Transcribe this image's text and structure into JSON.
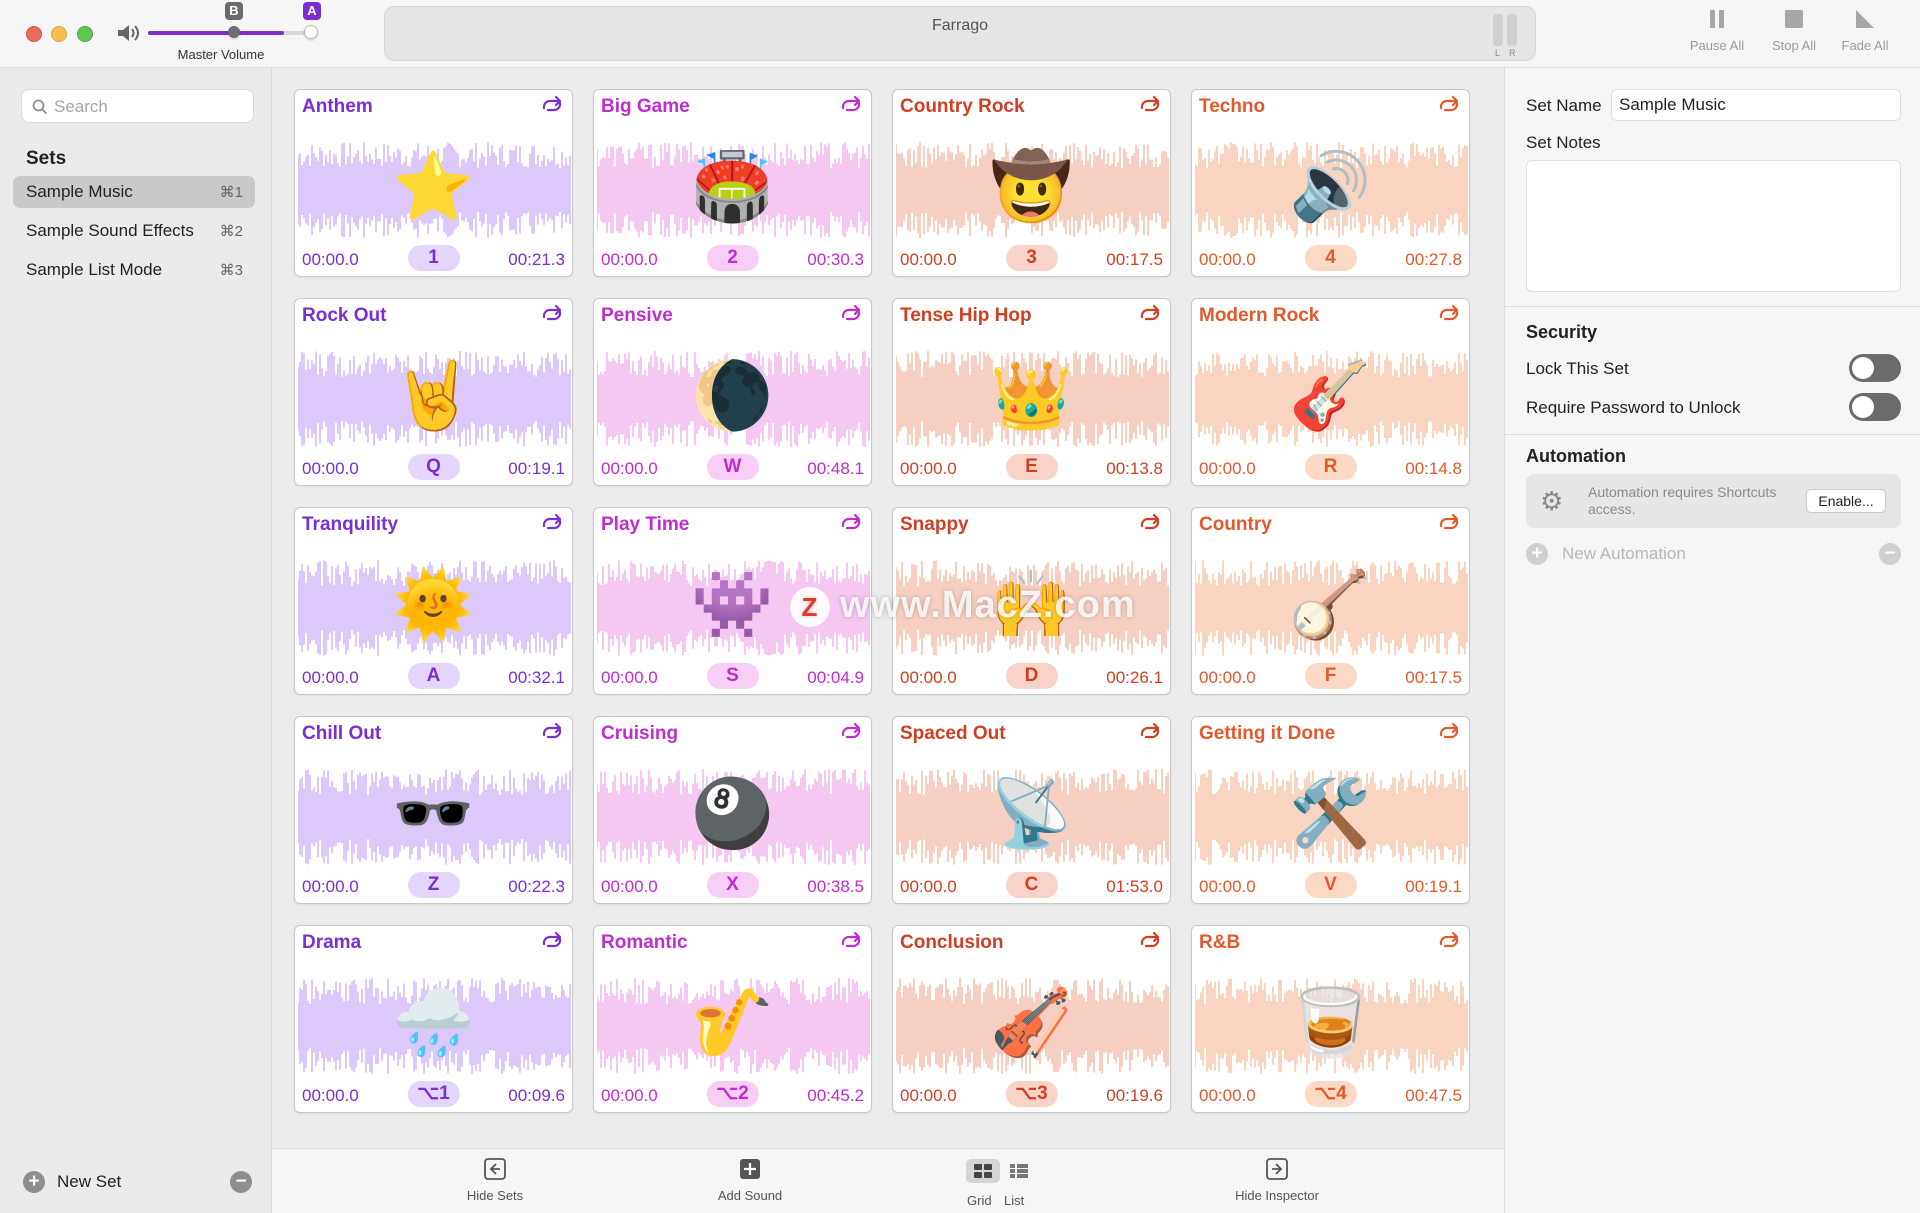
{
  "window": {
    "title": "Farrago"
  },
  "volume": {
    "label": "Master Volume",
    "marker_b": "B",
    "marker_a": "A",
    "level": 0.83
  },
  "meter": {
    "left": "L",
    "right": "R"
  },
  "toolbar": {
    "pause_all": "Pause All",
    "stop_all": "Stop All",
    "fade_all": "Fade All"
  },
  "sidebar": {
    "search_placeholder": "Search",
    "sets_heading": "Sets",
    "sets": [
      {
        "name": "Sample Music",
        "shortcut": "⌘1",
        "active": true
      },
      {
        "name": "Sample Sound Effects",
        "shortcut": "⌘2",
        "active": false
      },
      {
        "name": "Sample List Mode",
        "shortcut": "⌘3",
        "active": false
      }
    ],
    "new_set": "New Set"
  },
  "colors": {
    "purple": "#7b2fd0",
    "pink": "#c02ccf",
    "salmon": "#d03f22",
    "orange": "#e3592c"
  },
  "tiles": [
    {
      "title": "Anthem",
      "emoji": "⭐",
      "key": "1",
      "start": "00:00.0",
      "duration": "00:21.3",
      "color": "purple",
      "wave": "#dcc8fa"
    },
    {
      "title": "Big Game",
      "emoji": "🏟️",
      "key": "2",
      "start": "00:00.0",
      "duration": "00:30.3",
      "color": "pink",
      "wave": "#f4c8f1"
    },
    {
      "title": "Country Rock",
      "emoji": "🤠",
      "key": "3",
      "start": "00:00.0",
      "duration": "00:17.5",
      "color": "salmon",
      "wave": "#f7cfc2"
    },
    {
      "title": "Techno",
      "emoji": "🔊",
      "key": "4",
      "start": "00:00.0",
      "duration": "00:27.8",
      "color": "orange",
      "wave": "#f9d4c1"
    },
    {
      "title": "Rock Out",
      "emoji": "🤘",
      "key": "Q",
      "start": "00:00.0",
      "duration": "00:19.1",
      "color": "purple",
      "wave": "#dcc8fa"
    },
    {
      "title": "Pensive",
      "emoji": "🌘",
      "key": "W",
      "start": "00:00.0",
      "duration": "00:48.1",
      "color": "pink",
      "wave": "#f4c8f1"
    },
    {
      "title": "Tense Hip Hop",
      "emoji": "👑",
      "key": "E",
      "start": "00:00.0",
      "duration": "00:13.8",
      "color": "salmon",
      "wave": "#f7cfc2"
    },
    {
      "title": "Modern Rock",
      "emoji": "🎸",
      "key": "R",
      "start": "00:00.0",
      "duration": "00:14.8",
      "color": "orange",
      "wave": "#f9d4c1"
    },
    {
      "title": "Tranquility",
      "emoji": "🌞",
      "key": "A",
      "start": "00:00.0",
      "duration": "00:32.1",
      "color": "purple",
      "wave": "#dcc8fa"
    },
    {
      "title": "Play Time",
      "emoji": "👾",
      "key": "S",
      "start": "00:00.0",
      "duration": "00:04.9",
      "color": "pink",
      "wave": "#f4c8f1"
    },
    {
      "title": "Snappy",
      "emoji": "🙌",
      "key": "D",
      "start": "00:00.0",
      "duration": "00:26.1",
      "color": "salmon",
      "wave": "#f7cfc2"
    },
    {
      "title": "Country",
      "emoji": "🪕",
      "key": "F",
      "start": "00:00.0",
      "duration": "00:17.5",
      "color": "orange",
      "wave": "#f9d4c1"
    },
    {
      "title": "Chill Out",
      "emoji": "🕶️",
      "key": "Z",
      "start": "00:00.0",
      "duration": "00:22.3",
      "color": "purple",
      "wave": "#dcc8fa"
    },
    {
      "title": "Cruising",
      "emoji": "🎱",
      "key": "X",
      "start": "00:00.0",
      "duration": "00:38.5",
      "color": "pink",
      "wave": "#f4c8f1"
    },
    {
      "title": "Spaced Out",
      "emoji": "📡",
      "key": "C",
      "start": "00:00.0",
      "duration": "01:53.0",
      "color": "salmon",
      "wave": "#f7cfc2"
    },
    {
      "title": "Getting it Done",
      "emoji": "🛠️",
      "key": "V",
      "start": "00:00.0",
      "duration": "00:19.1",
      "color": "orange",
      "wave": "#f9d4c1"
    },
    {
      "title": "Drama",
      "emoji": "🌧️",
      "key": "⌥1",
      "start": "00:00.0",
      "duration": "00:09.6",
      "color": "purple",
      "wave": "#dcc8fa"
    },
    {
      "title": "Romantic",
      "emoji": "🎷",
      "key": "⌥2",
      "start": "00:00.0",
      "duration": "00:45.2",
      "color": "pink",
      "wave": "#f4c8f1"
    },
    {
      "title": "Conclusion",
      "emoji": "🎻",
      "key": "⌥3",
      "start": "00:00.0",
      "duration": "00:19.6",
      "color": "salmon",
      "wave": "#f7cfc2"
    },
    {
      "title": "R&B",
      "emoji": "🥃",
      "key": "⌥4",
      "start": "00:00.0",
      "duration": "00:47.5",
      "color": "orange",
      "wave": "#f9d4c1"
    }
  ],
  "watermark": {
    "badge": "Z",
    "text": "www.MacZ.com"
  },
  "bottombar": {
    "hide_sets": "Hide Sets",
    "add_sound": "Add Sound",
    "grid": "Grid",
    "list": "List",
    "hide_inspector": "Hide Inspector"
  },
  "inspector": {
    "set_name_label": "Set Name",
    "set_name_value": "Sample Music",
    "set_notes_label": "Set Notes",
    "security_heading": "Security",
    "lock_label": "Lock This Set",
    "require_password_label": "Require Password to Unlock",
    "automation_heading": "Automation",
    "automation_notice": "Automation requires Shortcuts access.",
    "enable_button": "Enable...",
    "new_automation": "New Automation"
  }
}
